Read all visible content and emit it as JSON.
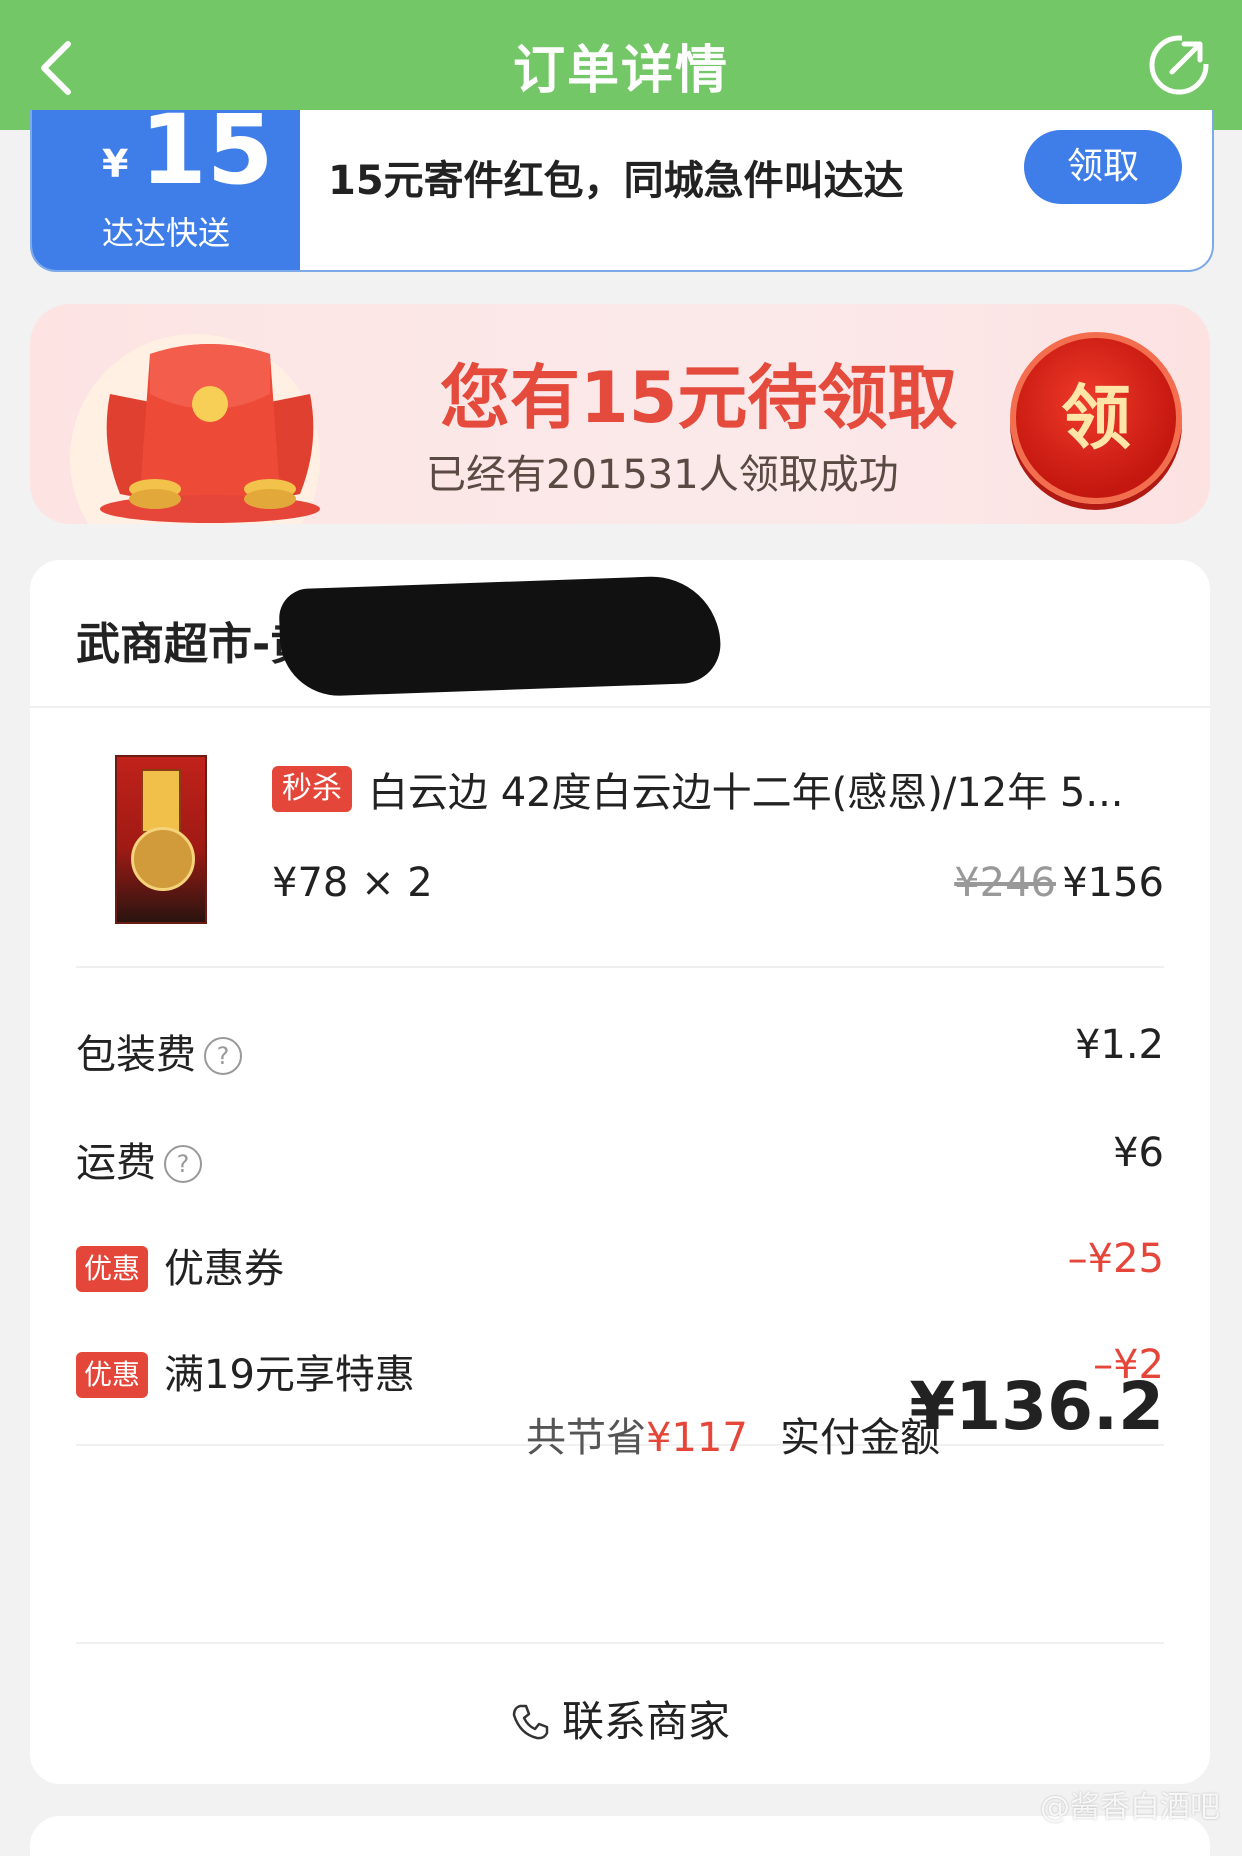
{
  "header": {
    "title": "订单详情"
  },
  "coupon": {
    "currency": "¥",
    "amount": "15",
    "brand": "达达快送",
    "text": "15元寄件红包，同城急件叫达达",
    "button": "领取"
  },
  "banner": {
    "headline": "您有15元待领取",
    "sub": "已经有201531人领取成功",
    "button": "领"
  },
  "store": {
    "name": "武商超市-黄",
    "chevron": ">"
  },
  "product": {
    "tag": "秒杀",
    "name": "白云边 42度白云边十二年(感恩)/12年 5...",
    "unit_price": "¥78 × 2",
    "original_price": "¥246",
    "subtotal": "¥156"
  },
  "fees": {
    "packaging_label": "包装费",
    "packaging_value": "¥1.2",
    "shipping_label": "运费",
    "shipping_value": "¥6",
    "coupon_tag": "优惠",
    "coupon_label": "优惠券",
    "coupon_value": "–¥25",
    "promo_tag": "优惠",
    "promo_label": "满19元享特惠",
    "promo_value": "–¥2"
  },
  "summary": {
    "saved_label": "共节省",
    "saved_value": "¥117",
    "pay_label": "实付金额",
    "pay_value": "¥136.2"
  },
  "contact": {
    "label": "联系商家"
  },
  "watermark": "@酱香白酒吧",
  "colors": {
    "header": "#74c767",
    "accent_blue": "#3f7ee8",
    "discount_red": "#e5463a"
  }
}
